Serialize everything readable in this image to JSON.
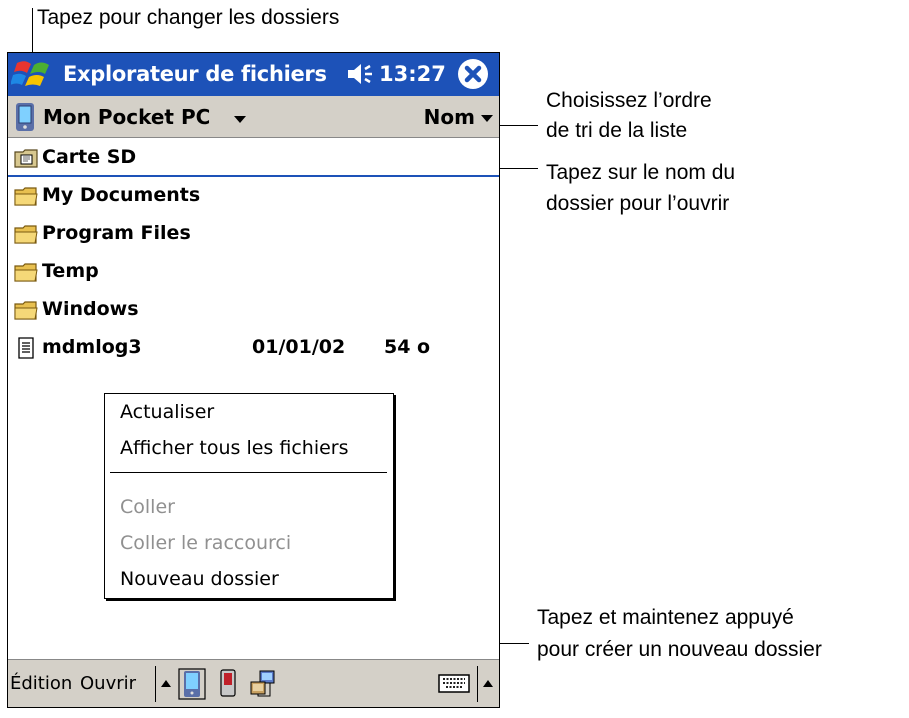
{
  "callouts": {
    "top": "Tapez pour changer les dossiers",
    "sort_line1": "Choisissez l’ordre",
    "sort_line2": "de tri de la liste",
    "open_line1": "Tapez sur le nom du",
    "open_line2": "dossier pour l’ouvrir",
    "new_line1": "Tapez et maintenez appuyé",
    "new_line2": "pour créer un nouveau dossier"
  },
  "titlebar": {
    "title": "Explorateur de fichiers",
    "time": "13:27"
  },
  "toolbar": {
    "location": "Mon Pocket PC",
    "sort": "Nom"
  },
  "files": [
    {
      "name": "Carte SD",
      "icon": "storage-card-icon"
    },
    {
      "name": "My Documents",
      "icon": "folder-icon"
    },
    {
      "name": "Program Files",
      "icon": "folder-icon"
    },
    {
      "name": "Temp",
      "icon": "folder-icon"
    },
    {
      "name": "Windows",
      "icon": "folder-icon"
    },
    {
      "name": "mdmlog3",
      "icon": "document-icon",
      "date": "01/01/02",
      "size": "54 o"
    }
  ],
  "context_menu": {
    "refresh": "Actualiser",
    "show_all": "Afficher tous les fichiers",
    "paste": "Coller",
    "paste_shortcut": "Coller le raccourci",
    "new_folder": "Nouveau dossier"
  },
  "bottombar": {
    "edit": "Édition",
    "open": "Ouvrir"
  },
  "colors": {
    "titlebar": "#1d52b8",
    "toolbar": "#d4d0c8",
    "disabled": "#909090"
  }
}
